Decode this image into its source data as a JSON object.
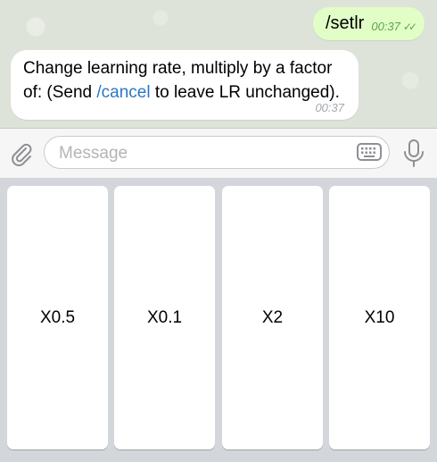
{
  "chat": {
    "outgoing": {
      "text": "/setlr",
      "time": "00:37",
      "status": "✓✓"
    },
    "incoming": {
      "text_part1": "Change learning rate, multiply by a factor of: (Send ",
      "command": "/cancel",
      "text_part2": " to leave LR unchanged).",
      "time": "00:37"
    }
  },
  "input": {
    "placeholder": "Message",
    "attach_icon": "paperclip-icon",
    "keyboard_icon": "keyboard-icon",
    "mic_icon": "microphone-icon"
  },
  "keyboard": {
    "buttons": [
      "X0.5",
      "X0.1",
      "X2",
      "X10"
    ]
  },
  "colors": {
    "outgoing_bubble": "#e1fec6",
    "incoming_bubble": "#ffffff",
    "link": "#2a77c6",
    "outgoing_meta": "#5fa34c"
  }
}
